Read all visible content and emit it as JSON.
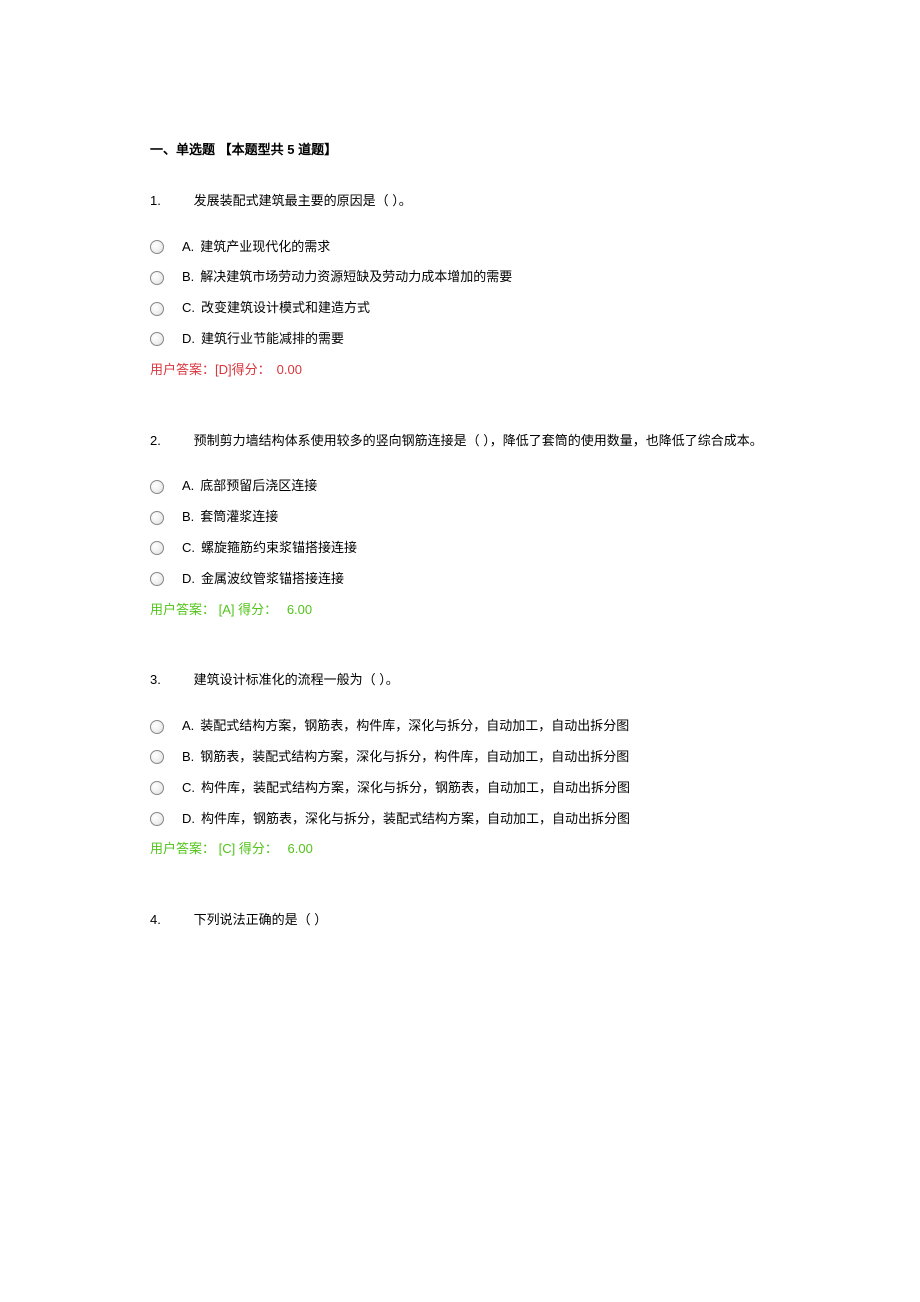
{
  "section_title": "一、单选题 【本题型共 5 道题】",
  "questions": [
    {
      "num": "1.",
      "stem": "发展装配式建筑最主要的原因是（ ）。",
      "options": [
        {
          "label": "A.",
          "text": "建筑产业现代化的需求"
        },
        {
          "label": "B.",
          "text": "解决建筑市场劳动力资源短缺及劳动力成本增加的需要"
        },
        {
          "label": "C.",
          "text": "改变建筑设计模式和建造方式"
        },
        {
          "label": "D.",
          "text": "建筑行业节能减排的需要"
        }
      ],
      "answer_prefix": "用户答案：",
      "answer_code": "[D]",
      "score_label": "得分：",
      "score_value": "0.00",
      "status": "wrong"
    },
    {
      "num": "2.",
      "stem": "预制剪力墙结构体系使用较多的竖向钢筋连接是（ ），降低了套筒的使用数量，也降低了综合成本。",
      "options": [
        {
          "label": "A.",
          "text": "底部预留后浇区连接"
        },
        {
          "label": "B.",
          "text": "套筒灌浆连接"
        },
        {
          "label": "C.",
          "text": "螺旋箍筋约束浆锚搭接连接"
        },
        {
          "label": "D.",
          "text": "金属波纹管浆锚搭接连接"
        }
      ],
      "answer_prefix": "用户答案：",
      "answer_code": "[A]",
      "score_label": "得分：",
      "score_value": "6.00",
      "status": "correct"
    },
    {
      "num": "3.",
      "stem": "建筑设计标准化的流程一般为（ ）。",
      "options": [
        {
          "label": "A.",
          "text": "装配式结构方案，钢筋表，构件库，深化与拆分，自动加工，自动出拆分图"
        },
        {
          "label": "B.",
          "text": "钢筋表，装配式结构方案，深化与拆分，构件库，自动加工，自动出拆分图"
        },
        {
          "label": "C.",
          "text": "构件库，装配式结构方案，深化与拆分，钢筋表，自动加工，自动出拆分图"
        },
        {
          "label": "D.",
          "text": "构件库，钢筋表，深化与拆分，装配式结构方案，自动加工，自动出拆分图"
        }
      ],
      "answer_prefix": "用户答案：",
      "answer_code": "[C]",
      "score_label": "得分：",
      "score_value": "6.00",
      "status": "correct"
    },
    {
      "num": "4.",
      "stem": "下列说法正确的是（ ）",
      "options": [],
      "answer_prefix": "",
      "answer_code": "",
      "score_label": "",
      "score_value": "",
      "status": ""
    }
  ]
}
